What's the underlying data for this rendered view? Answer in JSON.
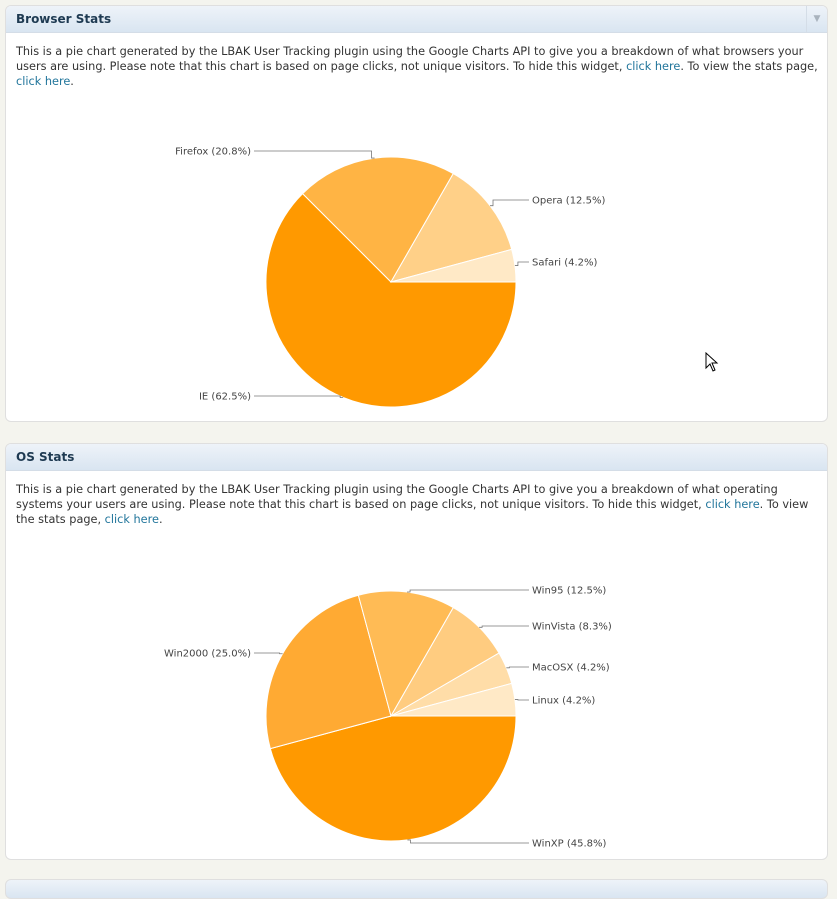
{
  "widgets": [
    {
      "title": "Browser Stats",
      "desc_text_1": "This is a pie chart generated by the LBAK User Tracking plugin using the Google Charts API to give you a breakdown of what browsers your users are using. Please note that this chart is based on page clicks, not unique visitors. To hide this widget, ",
      "hide_link": "click here",
      "desc_text_2": ". To view the stats page, ",
      "stats_link": "click here",
      "desc_text_3": "."
    },
    {
      "title": "OS Stats",
      "desc_text_1": "This is a pie chart generated by the LBAK User Tracking plugin using the Google Charts API to give you a breakdown of what operating systems your users are using. Please note that this chart is based on page clicks, not unique visitors. To hide this widget, ",
      "hide_link": "click here",
      "desc_text_2": ". To view the stats page, ",
      "stats_link": "click here",
      "desc_text_3": "."
    }
  ],
  "toggle_icon": "triangle-down-icon",
  "colors": {
    "link": "#21759b",
    "title": "#1e3a52",
    "slice_base": "#ff9900"
  },
  "chart_data": [
    {
      "type": "pie",
      "slices": [
        {
          "label": "IE (62.5%)",
          "value": 62.5,
          "color": "#ff9900"
        },
        {
          "label": "Firefox (20.8%)",
          "value": 20.8,
          "color": "#ffb444"
        },
        {
          "label": "Opera (12.5%)",
          "value": 12.5,
          "color": "#ffd088"
        },
        {
          "label": "Safari (4.2%)",
          "value": 4.2,
          "color": "#ffe9c6"
        }
      ]
    },
    {
      "type": "pie",
      "slices": [
        {
          "label": "WinXP (45.8%)",
          "value": 45.8,
          "color": "#ff9900"
        },
        {
          "label": "Win2000 (25.0%)",
          "value": 25.0,
          "color": "#ffaa33"
        },
        {
          "label": "Win95 (12.5%)",
          "value": 12.5,
          "color": "#ffbb55"
        },
        {
          "label": "WinVista (8.3%)",
          "value": 8.3,
          "color": "#ffcc80"
        },
        {
          "label": "MacOSX (4.2%)",
          "value": 4.2,
          "color": "#ffdda8"
        },
        {
          "label": "Linux (4.2%)",
          "value": 4.2,
          "color": "#ffe9c6"
        }
      ]
    }
  ]
}
